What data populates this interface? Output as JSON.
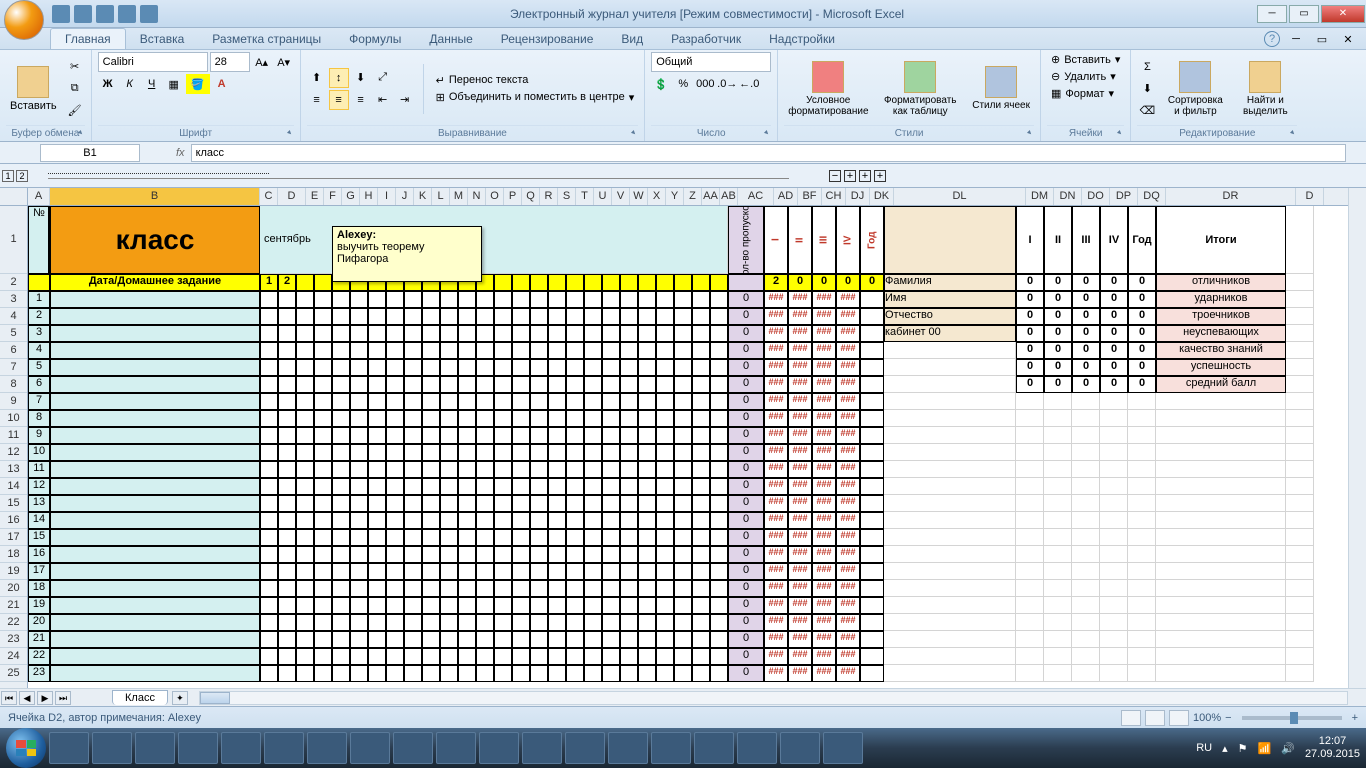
{
  "window": {
    "title": "Электронный журнал учителя  [Режим совместимости] - Microsoft Excel"
  },
  "ribbon": {
    "tabs": [
      "Главная",
      "Вставка",
      "Разметка страницы",
      "Формулы",
      "Данные",
      "Рецензирование",
      "Вид",
      "Разработчик",
      "Надстройки"
    ],
    "active_tab": "Главная",
    "groups": {
      "clipboard": {
        "label": "Буфер обмена",
        "paste": "Вставить"
      },
      "font": {
        "label": "Шрифт",
        "name": "Calibri",
        "size": "28"
      },
      "alignment": {
        "label": "Выравнивание",
        "wrap": "Перенос текста",
        "merge": "Объединить и поместить в центре"
      },
      "number": {
        "label": "Число",
        "format": "Общий"
      },
      "styles": {
        "label": "Стили",
        "cond": "Условное форматирование",
        "table": "Форматировать как таблицу",
        "cell": "Стили ячеек"
      },
      "cells": {
        "label": "Ячейки",
        "insert": "Вставить",
        "delete": "Удалить",
        "format": "Формат"
      },
      "editing": {
        "label": "Редактирование",
        "sort": "Сортировка и фильтр",
        "find": "Найти и выделить"
      }
    }
  },
  "namebox": "B1",
  "formula": "класс",
  "columns": [
    "A",
    "B",
    "C",
    "D",
    "E",
    "F",
    "G",
    "H",
    "I",
    "J",
    "K",
    "L",
    "M",
    "N",
    "O",
    "P",
    "Q",
    "R",
    "S",
    "T",
    "U",
    "V",
    "W",
    "X",
    "Y",
    "Z",
    "AA",
    "AB",
    "AC",
    "AD",
    "BF",
    "CH",
    "DJ",
    "DK",
    "DL",
    "DM",
    "DN",
    "DO",
    "DP",
    "DQ",
    "DR",
    "D"
  ],
  "header_row1": {
    "A": "№",
    "B": "класс",
    "C_month": "сентябрь",
    "AC": "Кол-во пропусков",
    "AD": "I",
    "BF": "II",
    "CH": "III",
    "DJ": "IV",
    "DK": "Год",
    "DM": "I",
    "DN": "II",
    "DO": "III",
    "DP": "IV",
    "DQ": "Год",
    "DR": "Итоги"
  },
  "row2": {
    "B": "Дата/Домашнее задание",
    "C": "1",
    "D": "2",
    "AC": "",
    "AD": "2",
    "BF": "0",
    "CH": "0",
    "DJ": "0",
    "DK": "0",
    "DL": "Фамилия",
    "DM": "0",
    "DN": "0",
    "DO": "0",
    "DP": "0",
    "DQ": "0",
    "DR": "отличников"
  },
  "side_labels": {
    "r3": "Имя",
    "r4": "Отчество",
    "r5": "кабинет 00"
  },
  "stats": [
    "отличников",
    "ударников",
    "троечников",
    "неуспевающих",
    "качество знаний",
    "успешность",
    "средний балл"
  ],
  "row_numbers_A": [
    "",
    "",
    "1",
    "2",
    "3",
    "4",
    "5",
    "6",
    "7",
    "8",
    "9",
    "10",
    "11",
    "12",
    "13",
    "14",
    "15",
    "16",
    "17",
    "18",
    "19",
    "20",
    "21",
    "22",
    "23"
  ],
  "hash": "###",
  "comment": {
    "author": "Alexey:",
    "text": "выучить теорему Пифагора"
  },
  "sheet_tab": "Класс",
  "statusbar": {
    "cell_info": "Ячейка D2, автор примечания: Alexey",
    "zoom": "100%"
  },
  "tray": {
    "lang": "RU",
    "time": "12:07",
    "date": "27.09.2015"
  }
}
